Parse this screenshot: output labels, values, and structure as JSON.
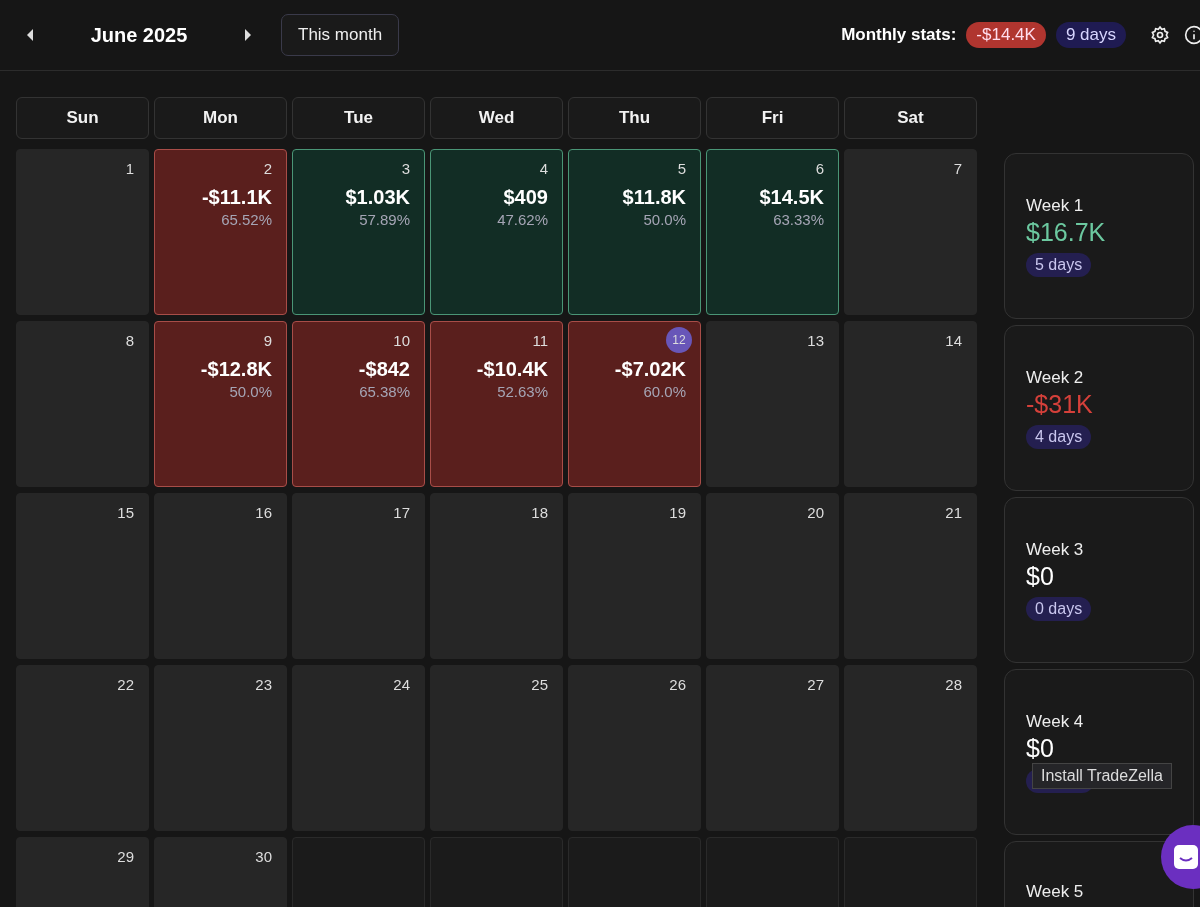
{
  "header": {
    "title": "June 2025",
    "today_button": "This month",
    "stats_label": "Monthly stats:",
    "stats_pnl": "-$14.4K",
    "stats_days": "9 days"
  },
  "weekdays": [
    "Sun",
    "Mon",
    "Tue",
    "Wed",
    "Thu",
    "Fri",
    "Sat"
  ],
  "weeks": [
    {
      "days": [
        {
          "kind": "day",
          "day": "1",
          "today": false
        },
        {
          "kind": "loss",
          "day": "2",
          "pnl": "-$11.1K",
          "winrate": "65.52%",
          "today": false
        },
        {
          "kind": "win",
          "day": "3",
          "pnl": "$1.03K",
          "winrate": "57.89%",
          "today": false
        },
        {
          "kind": "win",
          "day": "4",
          "pnl": "$409",
          "winrate": "47.62%",
          "today": false
        },
        {
          "kind": "win",
          "day": "5",
          "pnl": "$11.8K",
          "winrate": "50.0%",
          "today": false
        },
        {
          "kind": "win",
          "day": "6",
          "pnl": "$14.5K",
          "winrate": "63.33%",
          "today": false
        },
        {
          "kind": "day",
          "day": "7",
          "today": false
        }
      ],
      "summary": {
        "label": "Week 1",
        "pnl": "$16.7K",
        "gain": true,
        "loss": false,
        "days": "5 days"
      }
    },
    {
      "days": [
        {
          "kind": "day",
          "day": "8",
          "today": false
        },
        {
          "kind": "loss",
          "day": "9",
          "pnl": "-$12.8K",
          "winrate": "50.0%",
          "today": false
        },
        {
          "kind": "loss",
          "day": "10",
          "pnl": "-$842",
          "winrate": "65.38%",
          "today": false
        },
        {
          "kind": "loss",
          "day": "11",
          "pnl": "-$10.4K",
          "winrate": "52.63%",
          "today": false
        },
        {
          "kind": "loss",
          "day": "12",
          "pnl": "-$7.02K",
          "winrate": "60.0%",
          "today": true
        },
        {
          "kind": "day",
          "day": "13",
          "today": false
        },
        {
          "kind": "day",
          "day": "14",
          "today": false
        }
      ],
      "summary": {
        "label": "Week 2",
        "pnl": "-$31K",
        "gain": false,
        "loss": true,
        "days": "4 days"
      }
    },
    {
      "days": [
        {
          "kind": "day",
          "day": "15",
          "today": false
        },
        {
          "kind": "day",
          "day": "16",
          "today": false
        },
        {
          "kind": "day",
          "day": "17",
          "today": false
        },
        {
          "kind": "day",
          "day": "18",
          "today": false
        },
        {
          "kind": "day",
          "day": "19",
          "today": false
        },
        {
          "kind": "day",
          "day": "20",
          "today": false
        },
        {
          "kind": "day",
          "day": "21",
          "today": false
        }
      ],
      "summary": {
        "label": "Week 3",
        "pnl": "$0",
        "gain": false,
        "loss": false,
        "days": "0 days"
      }
    },
    {
      "days": [
        {
          "kind": "day",
          "day": "22",
          "today": false
        },
        {
          "kind": "day",
          "day": "23",
          "today": false
        },
        {
          "kind": "day",
          "day": "24",
          "today": false
        },
        {
          "kind": "day",
          "day": "25",
          "today": false
        },
        {
          "kind": "day",
          "day": "26",
          "today": false
        },
        {
          "kind": "day",
          "day": "27",
          "today": false
        },
        {
          "kind": "day",
          "day": "28",
          "today": false
        }
      ],
      "summary": {
        "label": "Week 4",
        "pnl": "$0",
        "gain": false,
        "loss": false,
        "days_hidden": true
      }
    },
    {
      "days": [
        {
          "kind": "day",
          "day": "29",
          "today": false
        },
        {
          "kind": "day",
          "day": "30",
          "today": false
        },
        {
          "kind": "outside"
        },
        {
          "kind": "outside"
        },
        {
          "kind": "outside"
        },
        {
          "kind": "outside"
        },
        {
          "kind": "outside"
        }
      ],
      "summary": {
        "label": "Week 5"
      }
    }
  ],
  "tooltip": "Install TradeZella"
}
